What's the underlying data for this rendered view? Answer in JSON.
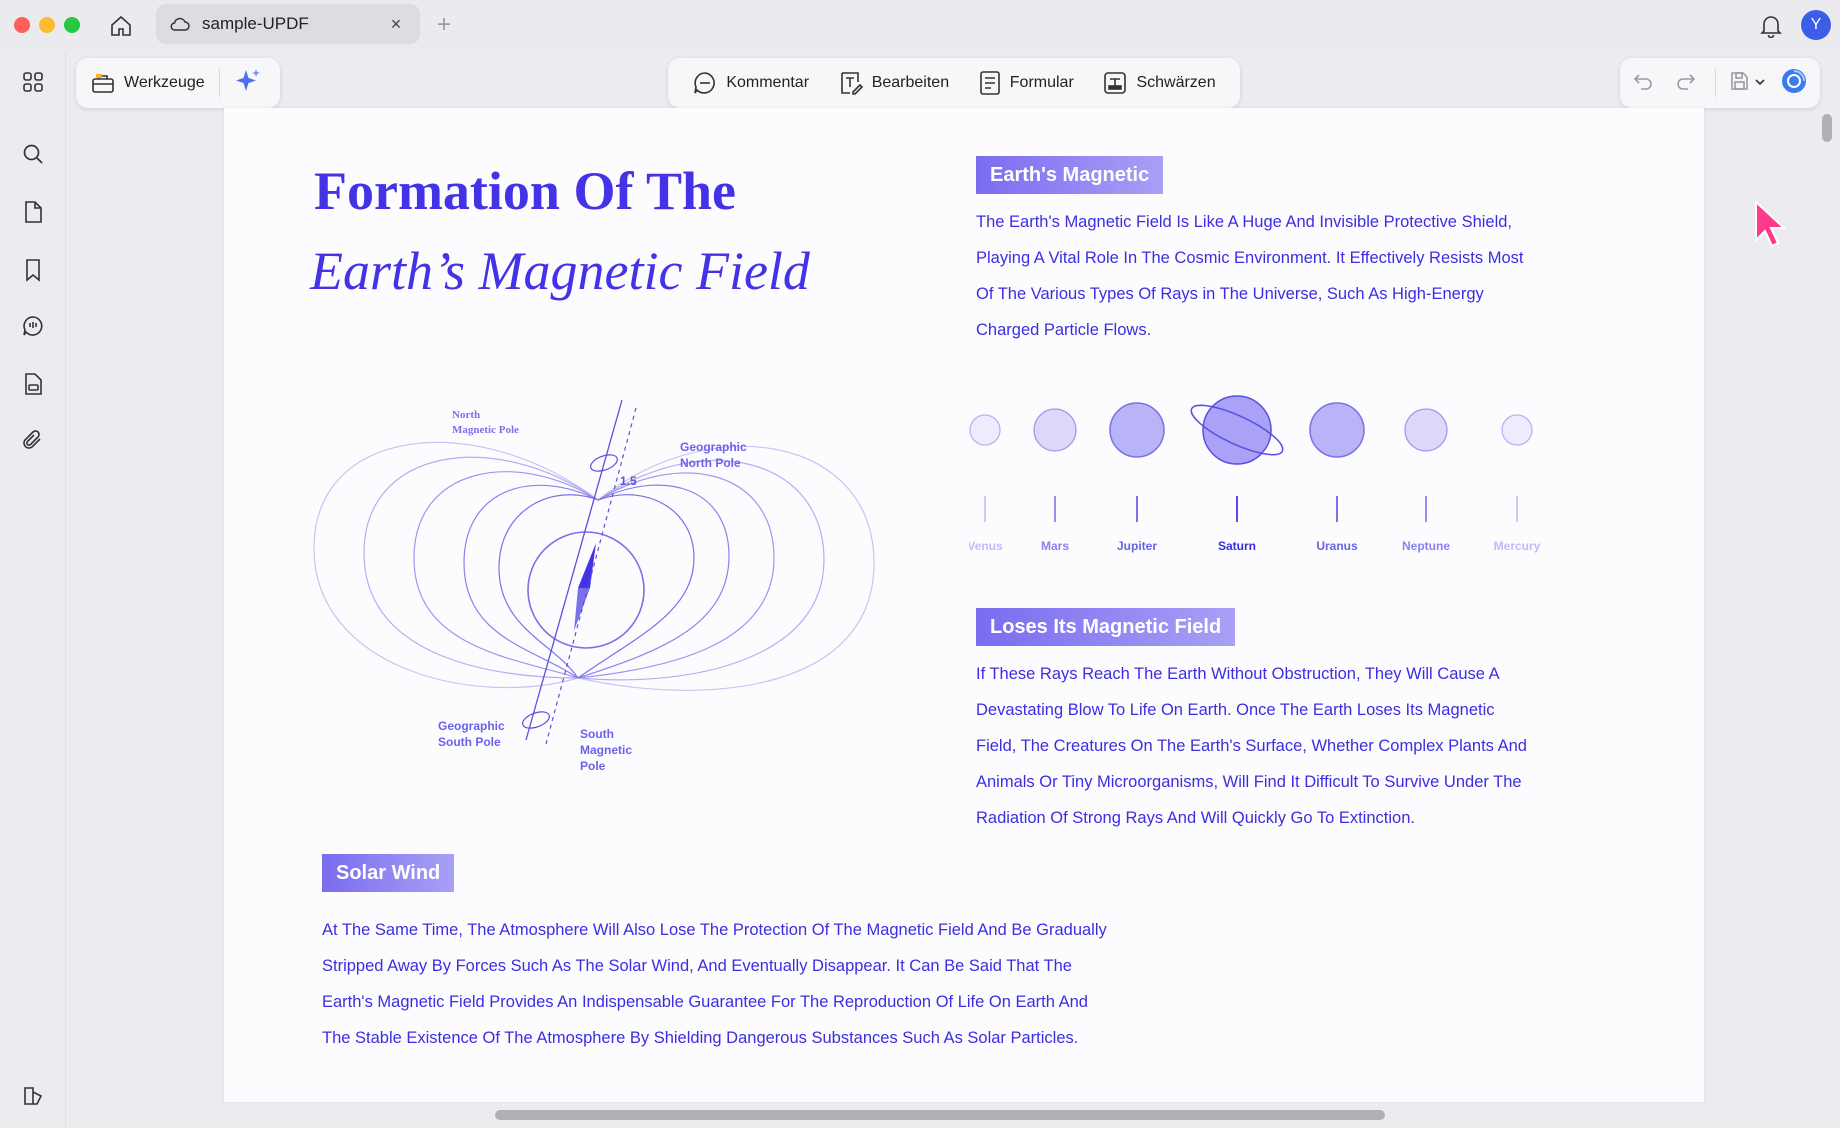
{
  "window": {
    "tab_title": "sample-UPDF",
    "tab_close": "×",
    "tab_add": "+",
    "avatar_initial": "Y"
  },
  "toolbar": {
    "tools_label": "Werkzeuge",
    "comment_label": "Kommentar",
    "edit_label": "Bearbeiten",
    "form_label": "Formular",
    "redact_label": "Schwärzen"
  },
  "document": {
    "title_line1": "Formation Of The",
    "title_line2": "Earth’s Magnetic Field",
    "diagram_labels": {
      "north_magnetic": [
        "North",
        "Magnetic Pole"
      ],
      "geographic_north": [
        "Geographic",
        "North Pole"
      ],
      "angle": "1.5",
      "geographic_south": [
        "Geographic",
        "South Pole"
      ],
      "south_magnetic": [
        "South",
        "Magnetic",
        "Pole"
      ]
    },
    "sections": {
      "earths_magnetic": {
        "heading": "Earth's Magnetic",
        "lines": [
          "The Earth's Magnetic Field Is Like A Huge And Invisible Protective Shield,",
          "Playing A Vital Role In The Cosmic Environment. It Effectively Resists Most",
          "Of The Various Types Of Rays in The Universe, Such As High-Energy",
          "Charged Particle Flows."
        ]
      },
      "loses_field": {
        "heading": "Loses Its Magnetic Field",
        "lines": [
          "If These Rays Reach The Earth Without Obstruction, They Will Cause A",
          "Devastating Blow To Life On Earth. Once The Earth Loses Its Magnetic",
          "Field, The Creatures On The Earth's Surface, Whether Complex Plants And",
          "Animals Or Tiny Microorganisms, Will Find It Difficult To Survive Under The",
          "Radiation Of Strong Rays And Will Quickly Go To Extinction."
        ]
      },
      "solar_wind": {
        "heading": "Solar Wind",
        "lines": [
          "At The Same Time, The Atmosphere Will Also Lose The Protection Of The Magnetic Field And Be Gradually",
          "Stripped Away By Forces Such As The Solar Wind, And Eventually Disappear. It Can Be Said That The",
          "Earth's Magnetic Field Provides An Indispensable Guarantee For The Reproduction Of Life On Earth And",
          "The Stable Existence Of The Atmosphere By Shielding Dangerous Substances Such As Solar Particles."
        ]
      }
    },
    "planets": [
      "Venus",
      "Mars",
      "Jupiter",
      "Saturn",
      "Uranus",
      "Neptune",
      "Mercury"
    ]
  },
  "colors": {
    "accent": "#4433e6",
    "badge_start": "#7a6cf0",
    "badge_end": "#a8a0f5",
    "cursor": "#ff3a8c"
  }
}
